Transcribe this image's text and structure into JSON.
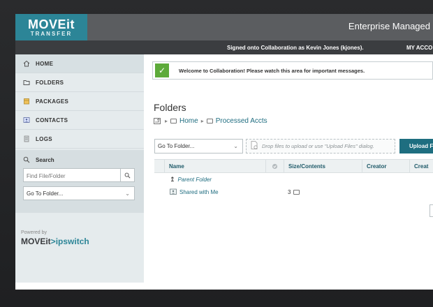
{
  "header": {
    "logo_main": "MOVEit",
    "logo_sub": "TRANSFER",
    "app_title": "Enterprise Managed"
  },
  "userbar": {
    "signed_in_text": "Signed onto Collaboration as Kevin Jones (kjones).",
    "my_account_label": "MY ACCO"
  },
  "sidebar": {
    "items": [
      {
        "label": "HOME",
        "icon": "home-icon"
      },
      {
        "label": "FOLDERS",
        "icon": "folder-icon"
      },
      {
        "label": "PACKAGES",
        "icon": "package-icon"
      },
      {
        "label": "CONTACTS",
        "icon": "contacts-icon"
      },
      {
        "label": "LOGS",
        "icon": "logs-icon"
      }
    ],
    "search": {
      "title": "Search",
      "find_placeholder": "Find File/Folder",
      "goto_label": "Go To Folder..."
    },
    "powered_by": "Powered by",
    "powered_brand_a": "MOVEit",
    "powered_brand_sep": ">",
    "powered_brand_b": "ipswitch"
  },
  "main": {
    "welcome_message": "Welcome to Collaboration! Please watch this area for important messages.",
    "page_title": "Folders",
    "breadcrumb": [
      "Home",
      "Processed Accts"
    ],
    "goto_select": "Go To Folder...",
    "dropzone_text": "Drop files to upload or use \"Upload Files\" dialog.",
    "upload_button": "Upload F",
    "table": {
      "columns": [
        "Name",
        "Size/Contents",
        "Creator",
        "Creat"
      ],
      "rows": [
        {
          "name": "Parent Folder",
          "size": ""
        },
        {
          "name": "Shared with Me",
          "size": "3"
        }
      ]
    }
  },
  "colors": {
    "brand_teal": "#2c8597",
    "upload_button": "#1e6e80",
    "success_green": "#5daa3a",
    "sidebar_bg": "#e5ebed"
  }
}
